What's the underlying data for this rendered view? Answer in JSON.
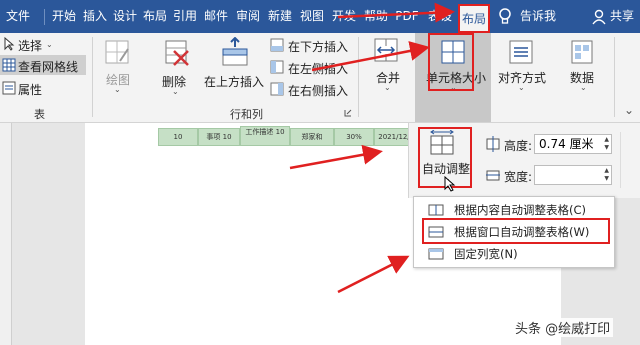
{
  "tabs": [
    {
      "label": "文件"
    },
    {
      "label": "开始"
    },
    {
      "label": "插入"
    },
    {
      "label": "设计"
    },
    {
      "label": "布局"
    },
    {
      "label": "引用"
    },
    {
      "label": "邮件"
    },
    {
      "label": "审阅"
    },
    {
      "label": "新建"
    },
    {
      "label": "视图"
    },
    {
      "label": "开发"
    },
    {
      "label": "帮助"
    },
    {
      "label": "PDF"
    },
    {
      "label": "表设"
    },
    {
      "label": "布局"
    }
  ],
  "tell_me": "告诉我",
  "share": "共享",
  "ribbon": {
    "select_label": "选择",
    "gridlines_label": "查看网格线",
    "properties_label": "属性",
    "table_group_label": "表",
    "draw_label": "绘图",
    "delete_label": "删除",
    "insert_above_label": "在上方插入",
    "insert_below_label": "在下方插入",
    "insert_left_label": "在左侧插入",
    "insert_right_label": "在右侧插入",
    "rows_cols_group_label": "行和列",
    "merge_label": "合并",
    "cell_size_label": "单元格大小",
    "alignment_label": "对齐方式",
    "data_label": "数据"
  },
  "table_row": [
    "10",
    "事项 10",
    "工作描述 10",
    "郑家和",
    "30%",
    "2021/12/"
  ],
  "autofit_panel": {
    "autofit_label": "自动调整",
    "height_label": "高度:",
    "height_value": "0.74 厘米",
    "width_label": "宽度:",
    "width_value": ""
  },
  "autofit_menu": [
    {
      "label": "根据内容自动调整表格(C)"
    },
    {
      "label": "根据窗口自动调整表格(W)"
    },
    {
      "label": "固定列宽(N)"
    }
  ],
  "watermark": "头条 @绘威打印",
  "colors": {
    "accent": "#2b579a",
    "highlight_red": "#e02020",
    "table_fill": "#c6e0c6"
  }
}
